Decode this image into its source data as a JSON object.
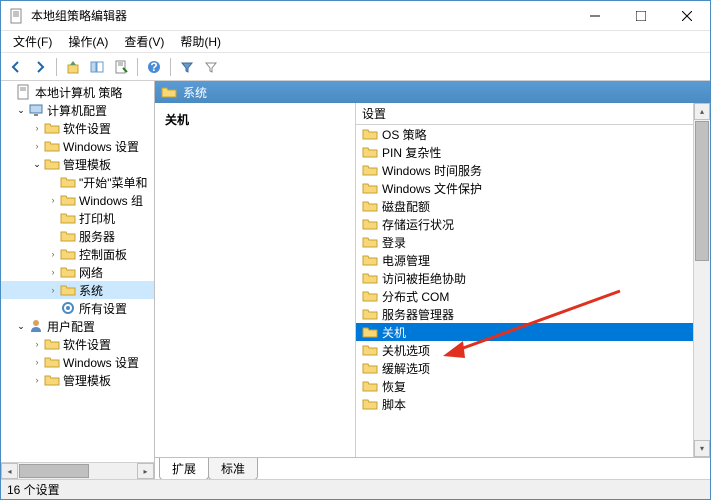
{
  "window": {
    "title": "本地组策略编辑器"
  },
  "menu": {
    "file": "文件(F)",
    "action": "操作(A)",
    "view": "查看(V)",
    "help": "帮助(H)"
  },
  "tree": {
    "root": "本地计算机 策略",
    "computer_config": "计算机配置",
    "software_settings": "软件设置",
    "windows_settings": "Windows 设置",
    "admin_templates": "管理模板",
    "start_menu": "\"开始\"菜单和",
    "windows_components": "Windows 组",
    "printers": "打印机",
    "servers": "服务器",
    "control_panel": "控制面板",
    "network": "网络",
    "system": "系统",
    "all_settings": "所有设置",
    "user_config": "用户配置",
    "u_software": "软件设置",
    "u_windows": "Windows 设置",
    "u_admin": "管理模板"
  },
  "content": {
    "header": "系统",
    "left_heading": "关机",
    "right_heading": "设置",
    "items": [
      "OS 策略",
      "PIN 复杂性",
      "Windows 时间服务",
      "Windows 文件保护",
      "磁盘配额",
      "存储运行状况",
      "登录",
      "电源管理",
      "访问被拒绝协助",
      "分布式 COM",
      "服务器管理器",
      "关机",
      "关机选项",
      "缓解选项",
      "恢复",
      "脚本"
    ],
    "selected_index": 11
  },
  "tabs": {
    "extended": "扩展",
    "standard": "标准"
  },
  "status": {
    "text": "16 个设置"
  }
}
